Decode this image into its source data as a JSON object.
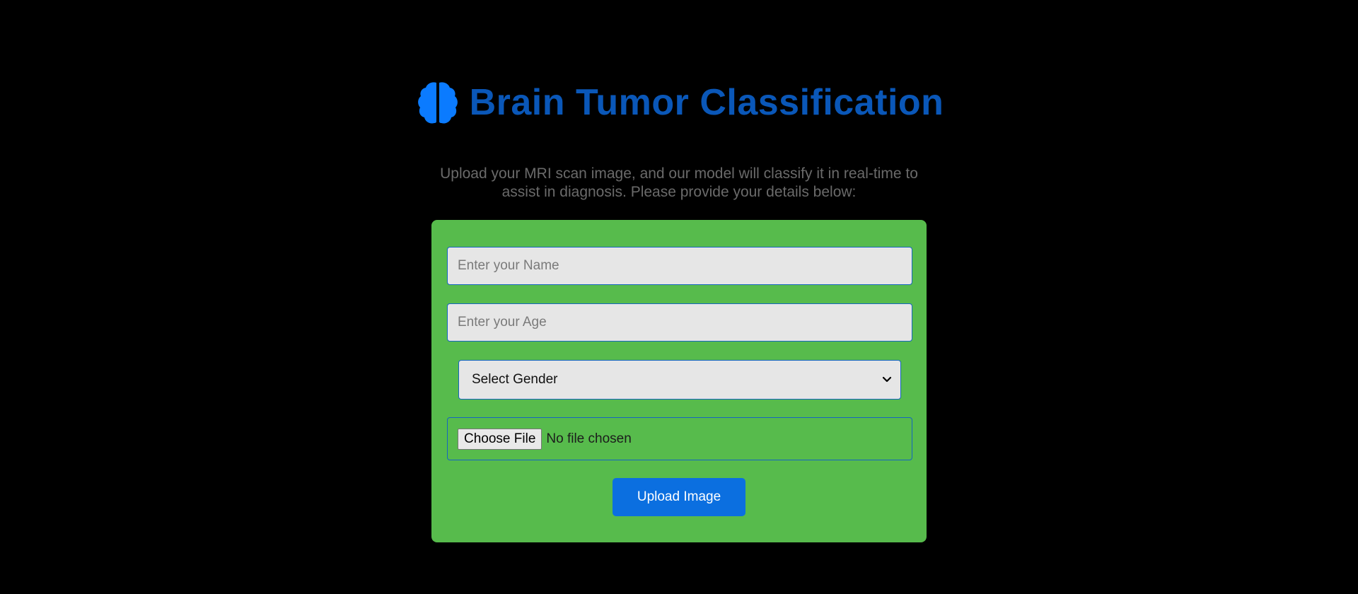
{
  "header": {
    "icon": "brain-icon",
    "title": "Brain Tumor Classification"
  },
  "intro": {
    "text": "Upload your MRI scan image, and our model will classify it in real-time to assist in diagnosis. Please provide your details below:"
  },
  "form": {
    "name_placeholder": "Enter your Name",
    "age_placeholder": "Enter your Age",
    "gender_selected": "Select Gender",
    "choose_file_label": "Choose File",
    "file_status": "No file chosen",
    "upload_label": "Upload Image"
  },
  "colors": {
    "background": "#000000",
    "title": "#0a57b8",
    "icon": "#0b7bff",
    "card": "#57bb4c",
    "field_border": "#1565c0",
    "button": "#0b6fe0"
  }
}
